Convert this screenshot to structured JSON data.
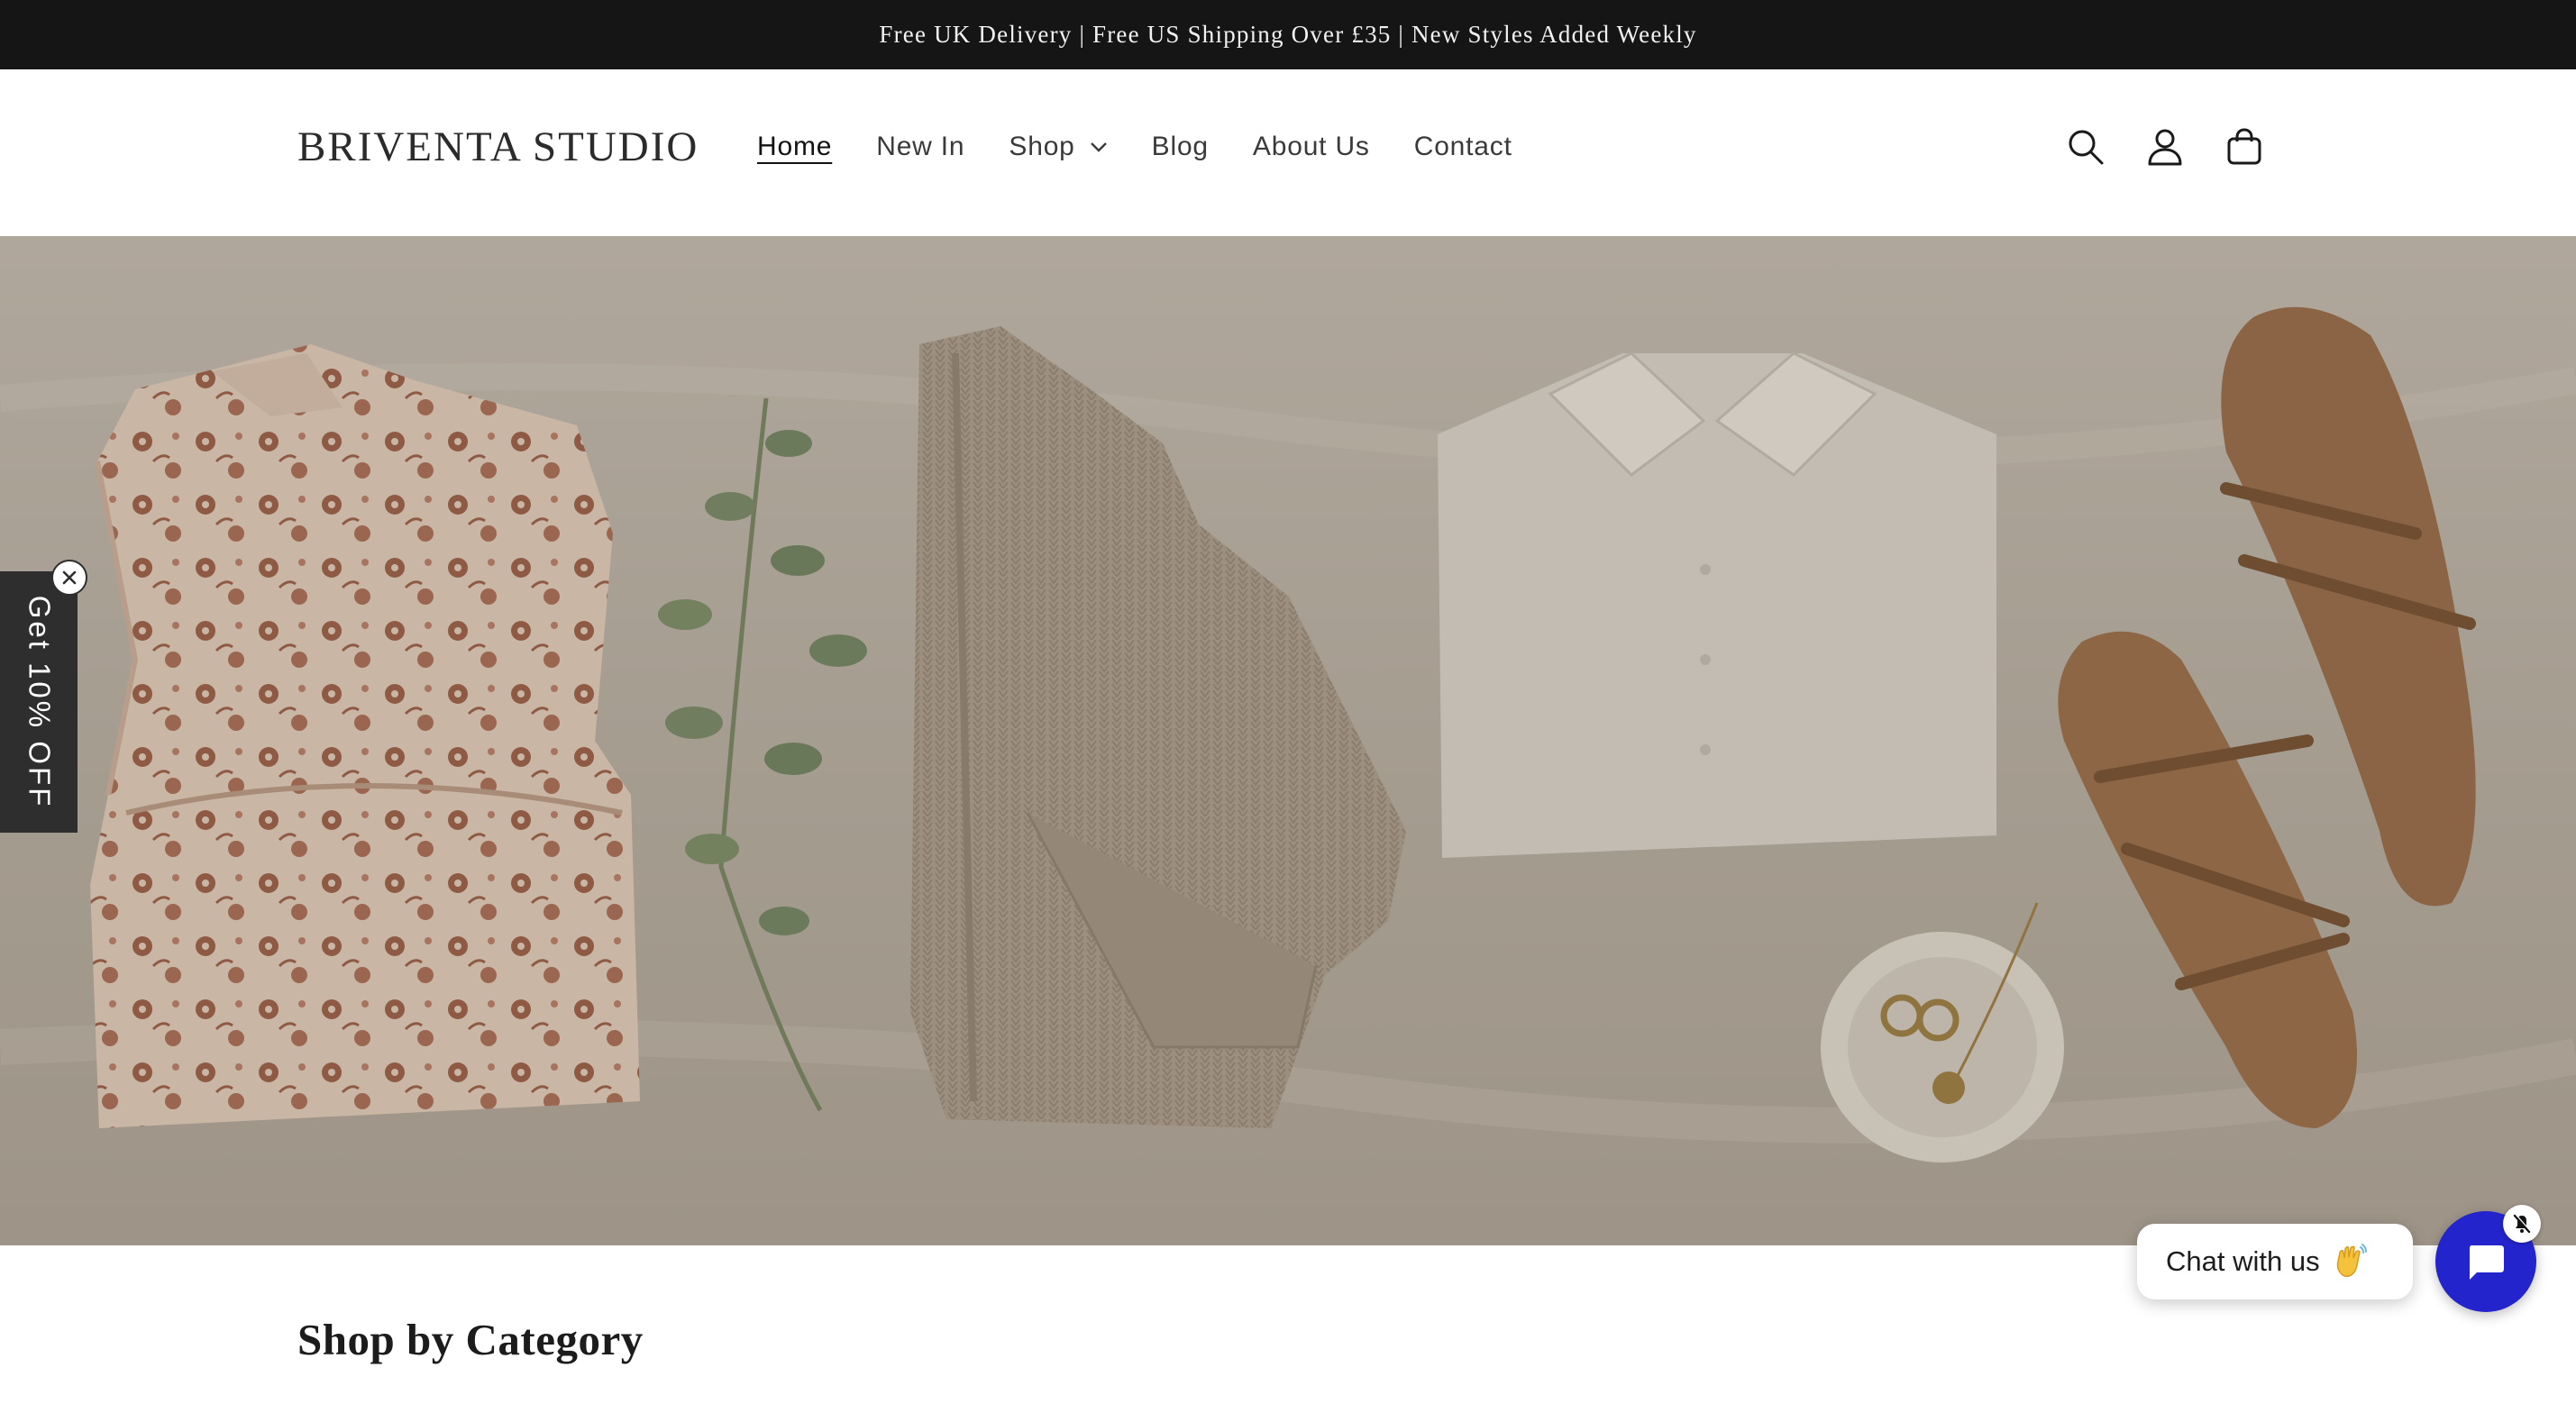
{
  "announcement": {
    "text": "Free UK Delivery | Free US Shipping Over £35 | New Styles Added Weekly"
  },
  "header": {
    "logo": "BRIVENTA STUDIO",
    "nav": [
      {
        "label": "Home",
        "active": true
      },
      {
        "label": "New In"
      },
      {
        "label": "Shop",
        "has_dropdown": true
      },
      {
        "label": "Blog"
      },
      {
        "label": "About Us"
      },
      {
        "label": "Contact"
      }
    ],
    "icons": [
      "search-icon",
      "account-icon",
      "cart-icon"
    ]
  },
  "hero": {
    "items": [
      "floral-dress",
      "eucalyptus-sprig",
      "knit-cardigan",
      "linen-shirt",
      "jewelry-dish",
      "leather-sandals"
    ],
    "colors": {
      "linen": "#a89f93",
      "overlay_tone": "#9e9488"
    }
  },
  "discount_tab": {
    "label": "Get 10% OFF"
  },
  "sections": {
    "category_title": "Shop by Category"
  },
  "chat": {
    "label": "Chat with us",
    "emoji": "wave-icon",
    "accent": "#2424cc"
  },
  "colors": {
    "announcement_bg": "#151515",
    "text": "#121212",
    "tab_bg": "#2e2e2e"
  }
}
